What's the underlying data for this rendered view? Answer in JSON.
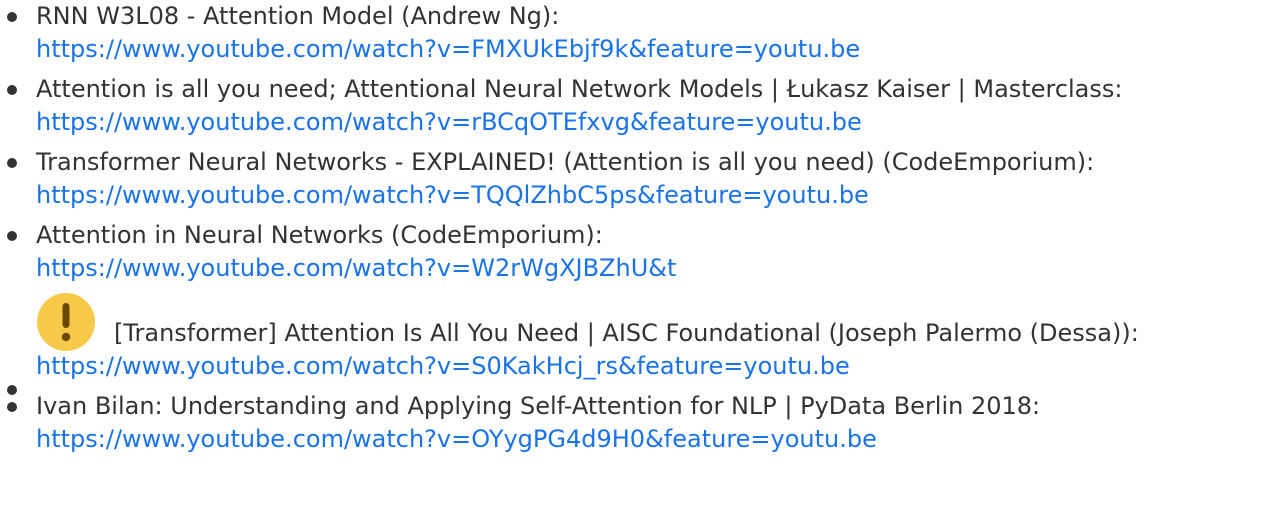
{
  "items": [
    {
      "title": "RNN W3L08 - Attention Model (Andrew Ng):",
      "url": "https://www.youtube.com/watch?v=FMXUkEbjf9k&feature=youtu.be"
    },
    {
      "title": "Attention is all you need; Attentional Neural Network Models | Łukasz Kaiser | Masterclass:",
      "url": "https://www.youtube.com/watch?v=rBCqOTEfxvg&feature=youtu.be"
    },
    {
      "title": "Transformer Neural Networks - EXPLAINED! (Attention is all you need) (CodeEmporium):",
      "url": "https://www.youtube.com/watch?v=TQQlZhbC5ps&feature=youtu.be"
    },
    {
      "title": "Attention in Neural Networks (CodeEmporium):",
      "url": "https://www.youtube.com/watch?v=W2rWgXJBZhU&t"
    },
    {
      "icon": "exclamation-warning-icon",
      "title": "[Transformer] Attention Is All You Need | AISC Foundational (Joseph Palermo (Dessa)):",
      "url": "https://www.youtube.com/watch?v=S0KakHcj_rs&feature=youtu.be"
    },
    {
      "title": "Ivan Bilan: Understanding and Applying Self-Attention for NLP | PyData Berlin 2018:",
      "url": "https://www.youtube.com/watch?v=OYygPG4d9H0&feature=youtu.be"
    }
  ],
  "colors": {
    "text": "#333333",
    "link": "#1a73e8",
    "icon_fill": "#f7c948",
    "icon_mark": "#6b4a00"
  }
}
